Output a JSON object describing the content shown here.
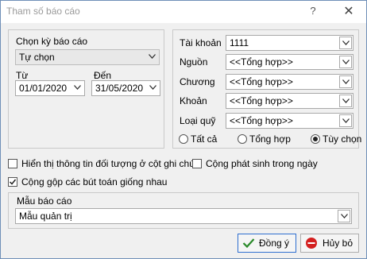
{
  "window": {
    "title": "Tham số báo cáo",
    "help_symbol": "?",
    "close_symbol": "✕"
  },
  "period": {
    "label": "Chọn kỳ báo cáo",
    "selected": "Tự chọn",
    "from_label": "Từ",
    "from_value": "01/01/2020",
    "to_label": "Đến",
    "to_value": "31/05/2020"
  },
  "filters": {
    "account_label": "Tài khoản",
    "account_value": "1111",
    "source_label": "Nguồn",
    "source_value": "<<Tổng hợp>>",
    "chapter_label": "Chương",
    "chapter_value": "<<Tổng hợp>>",
    "item_label": "Khoản",
    "item_value": "<<Tổng hợp>>",
    "fund_label": "Loại quỹ",
    "fund_value": "<<Tổng hợp>>",
    "radio_all": "Tất cả",
    "radio_summary": "Tổng hợp",
    "radio_custom": "Tùy chọn",
    "radio_selected": "custom"
  },
  "options": {
    "show_object_info": {
      "label": "Hiển thị thông tin đối tượng ở cột ghi chú",
      "checked": false
    },
    "add_daily_totals": {
      "label": "Cộng phát sinh trong ngày",
      "checked": false
    },
    "merge_same_entries": {
      "label": "Cộng gộp các bút toán giống nhau",
      "checked": true
    }
  },
  "template": {
    "label": "Mẫu báo cáo",
    "value": "Mẫu quản trị"
  },
  "buttons": {
    "ok_label": "Đồng ý",
    "cancel_label": "Hủy bỏ"
  },
  "icons": [
    "help-icon",
    "close-icon",
    "chevron-down-icon",
    "checkmark-icon",
    "cancel-icon"
  ],
  "colors": {
    "accent": "#2f6fd0",
    "ok_check": "#2a8a2a",
    "cancel_red": "#d42020"
  }
}
